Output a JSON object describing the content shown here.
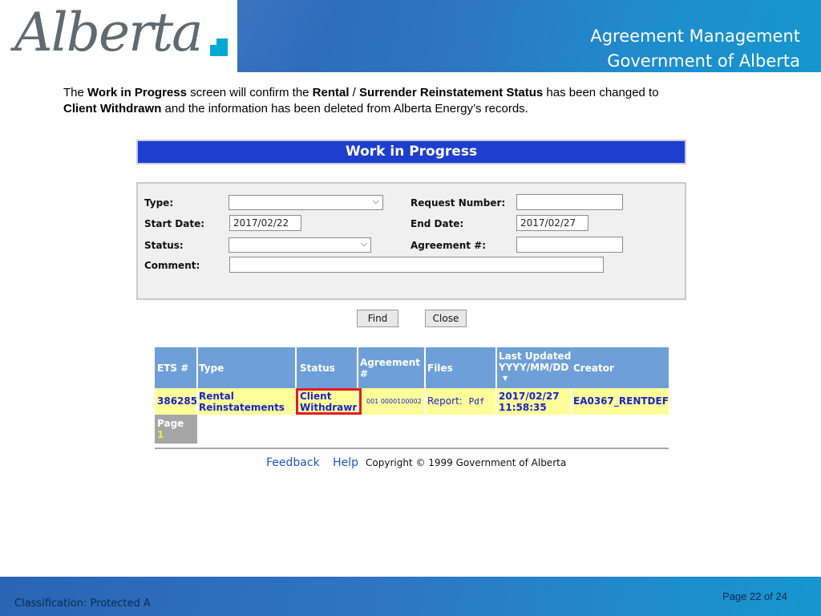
{
  "header": {
    "logo_text": "Alberta",
    "title_line1": "Agreement Management",
    "title_line2": "Government of Alberta"
  },
  "intro": {
    "p1": "The ",
    "b1": "Work in Progress",
    "p2": " screen will confirm the ",
    "b2": "Rental",
    "p3": " / ",
    "b3": "Surrender Reinstatement Status",
    "p4": " has been changed to ",
    "b4": "Client Withdrawn",
    "p5": " and the information has been deleted from Alberta Energy’s records."
  },
  "wip": {
    "title": "Work in Progress",
    "form": {
      "type_label": "Type:",
      "type_value": "",
      "start_date_label": "Start Date:",
      "start_date_value": "2017/02/22",
      "status_label": "Status:",
      "status_value": "",
      "comment_label": "Comment:",
      "comment_value": "",
      "request_number_label": "Request Number:",
      "request_number_value": "",
      "end_date_label": "End Date:",
      "end_date_value": "2017/02/27",
      "agreement_label": "Agreement #:",
      "agreement_value": ""
    },
    "buttons": {
      "find": "Find",
      "close": "Close"
    },
    "table": {
      "headers": {
        "ets": "ETS #",
        "type": "Type",
        "status": "Status",
        "agreement_l1": "Agreement",
        "agreement_l2": "#",
        "files": "Files",
        "last_updated_l1": "Last Updated",
        "last_updated_l2": "YYYY/MM/DD",
        "sort_arrow": "▼",
        "creator": "Creator"
      },
      "row": {
        "ets": "386285",
        "type_l1": "Rental",
        "type_l2": "Reinstatements",
        "status_l1": "Client",
        "status_l2": "Withdrawn",
        "agreement": "001 0000100002",
        "files_label": "Report:",
        "files_link": "Pdf",
        "updated_l1": "2017/02/27",
        "updated_l2": "11:58:35",
        "creator": "EA0367_RENTDEF"
      },
      "pager": {
        "label": "Page",
        "number": "1"
      }
    },
    "footer": {
      "feedback": "Feedback",
      "help": "Help",
      "copyright": "Copyright © 1999 Government of Alberta"
    }
  },
  "page_footer": {
    "classification": "Classification: Protected A",
    "page": "Page 22 of 24"
  },
  "colors": {
    "header_blue": "#2f73c2",
    "wip_title_blue": "#1e3ecf",
    "table_header": "#6f9fd8",
    "row_yellow": "#ffff99",
    "highlight_red": "#e31b23"
  }
}
